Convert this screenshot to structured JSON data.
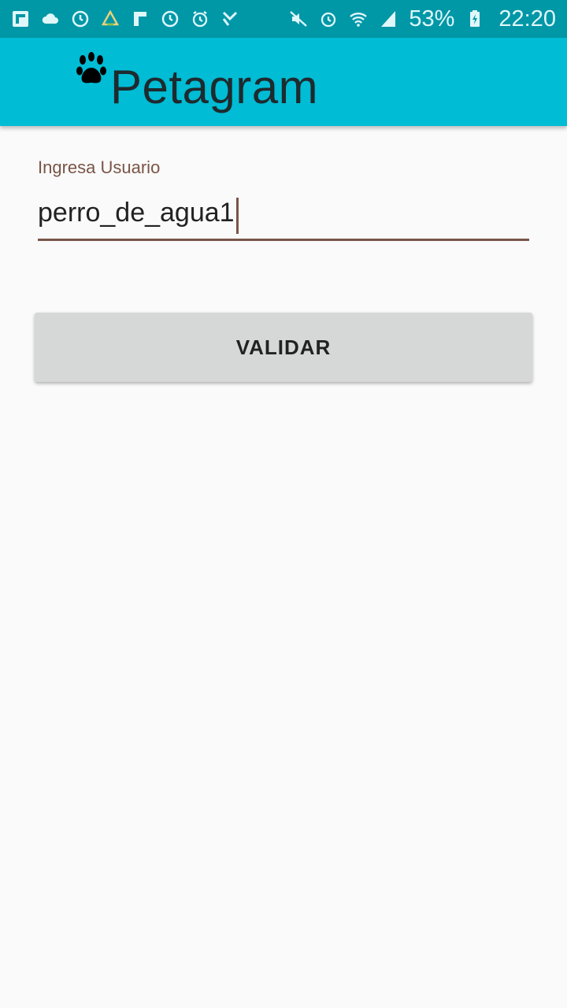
{
  "status_bar": {
    "left_icons": [
      "flipboard-icon",
      "cloud-icon",
      "sync-icon",
      "drive-icon",
      "flipboard-f-icon",
      "sync-icon-2",
      "alarm-icon",
      "feedly-icon"
    ],
    "right_icons": [
      "mute-icon",
      "alarm-clock-icon",
      "wifi-icon",
      "signal-icon"
    ],
    "battery": "53%",
    "time": "22:20"
  },
  "app_bar": {
    "logo": "paw-icon",
    "title": "Petagram",
    "color": "#00bcd4"
  },
  "form": {
    "label": "Ingresa Usuario",
    "value": "perro_de_agua1",
    "accent_color": "#795548"
  },
  "button": {
    "label": "VALIDAR"
  }
}
